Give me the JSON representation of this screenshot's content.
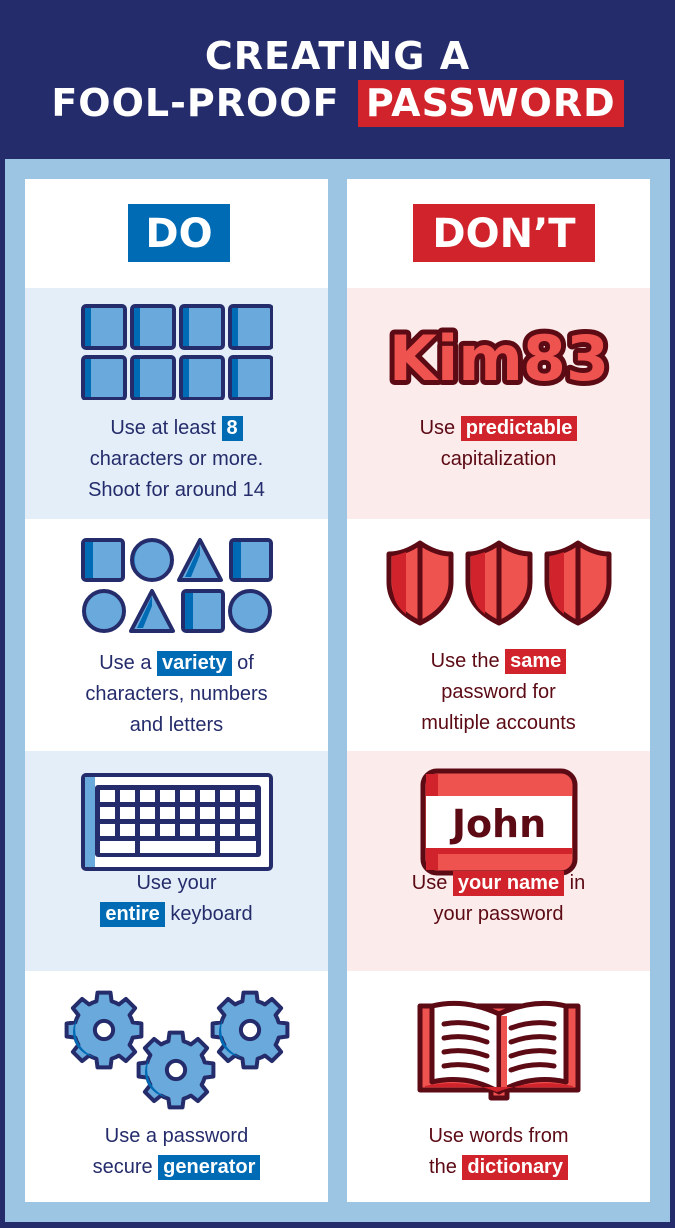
{
  "header": {
    "title_line1": "CREATING A",
    "title_line2_prefix": "FOOL-PROOF",
    "title_line2_highlight": "PASSWORD"
  },
  "colors": {
    "navy": "#252c6b",
    "frame_blue": "#9cc5e3",
    "do_blue": "#006bb5",
    "do_light": "#6aa9db",
    "do_tint": "#e3eef8",
    "dont_red": "#d1232b",
    "dont_light": "#ef5350",
    "dont_dark": "#5c0a14",
    "dont_tint": "#fcebeb"
  },
  "do": {
    "heading": "DO",
    "items": [
      {
        "icon": "character-boxes-icon",
        "line1_pre": "Use at least ",
        "line1_hl": "8",
        "line2": "characters or more.",
        "line3": "Shoot for around 14"
      },
      {
        "icon": "shapes-variety-icon",
        "line1_pre": "Use a ",
        "line1_hl": "variety",
        "line1_post": " of",
        "line2": "characters, numbers",
        "line3": "and letters"
      },
      {
        "icon": "keyboard-icon",
        "line1": "Use your",
        "line2_hl": "entire",
        "line2_post": " keyboard"
      },
      {
        "icon": "gears-icon",
        "line1": "Use a password",
        "line2_pre": "secure ",
        "line2_hl": "generator"
      }
    ]
  },
  "dont": {
    "heading": "DON’T",
    "items": [
      {
        "icon": "kim83-text-icon",
        "icon_text": "Kim83",
        "line1_pre": "Use ",
        "line1_hl": "predictable",
        "line2": "capitalization"
      },
      {
        "icon": "shields-icon",
        "line1_pre": "Use the ",
        "line1_hl": "same",
        "line2": "password for",
        "line3": "multiple accounts"
      },
      {
        "icon": "name-tag-icon",
        "icon_text": "John",
        "line1_pre": "Use ",
        "line1_hl": "your name",
        "line1_post": " in",
        "line2": "your password"
      },
      {
        "icon": "dictionary-book-icon",
        "line1": "Use words from",
        "line2_pre": "the ",
        "line2_hl": "dictionary"
      }
    ]
  }
}
